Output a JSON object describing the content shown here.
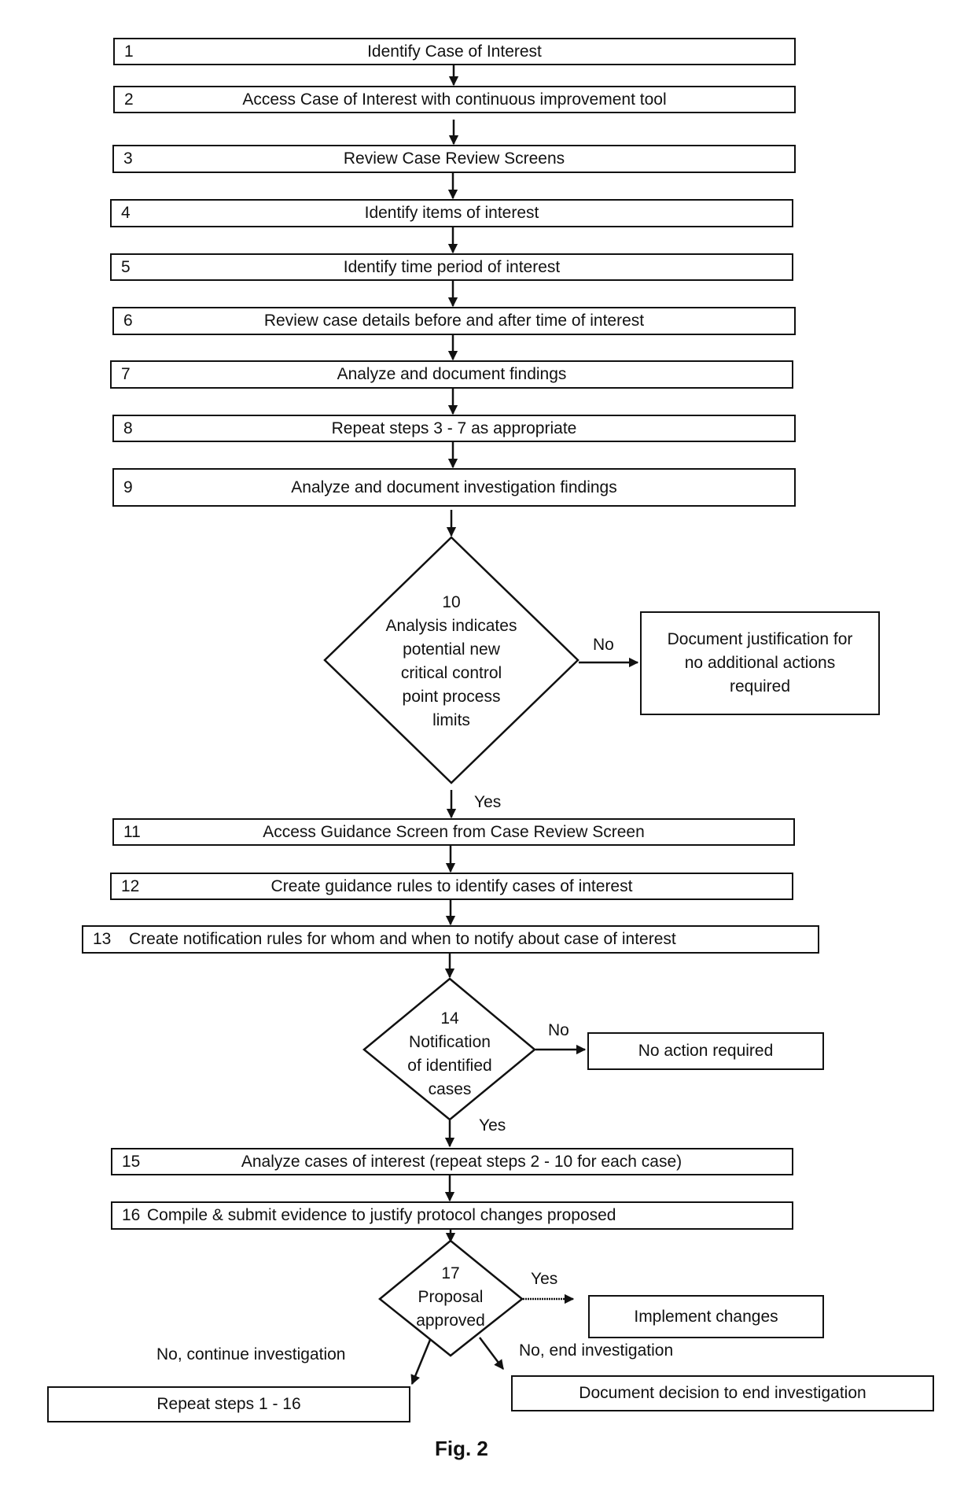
{
  "figure": {
    "caption": "Fig. 2",
    "steps": [
      {
        "num": "1",
        "label": "Identify Case of Interest"
      },
      {
        "num": "2",
        "label": "Access Case of Interest with continuous improvement tool"
      },
      {
        "num": "3",
        "label": "Review Case Review Screens"
      },
      {
        "num": "4",
        "label": "Identify items of interest"
      },
      {
        "num": "5",
        "label": "Identify time period of interest"
      },
      {
        "num": "6",
        "label": "Review case details before and after time of interest"
      },
      {
        "num": "7",
        "label": "Analyze and document findings"
      },
      {
        "num": "8",
        "label": "Repeat steps 3 - 7 as appropriate"
      },
      {
        "num": "9",
        "label": "Analyze and document investigation findings"
      },
      {
        "num": "11",
        "label": "Access Guidance Screen from Case Review Screen"
      },
      {
        "num": "12",
        "label": "Create guidance rules to identify cases of interest"
      },
      {
        "num": "13",
        "label": "Create notification rules for whom and when to notify about case of interest"
      },
      {
        "num": "15",
        "label": "Analyze cases of interest (repeat steps 2 - 10 for each case)"
      },
      {
        "num": "16",
        "label": "Compile & submit evidence to justify protocol changes proposed"
      }
    ],
    "decisions": [
      {
        "num": "10",
        "lines": [
          "Analysis indicates",
          "potential new",
          "critical control",
          "point process",
          "limits"
        ],
        "no_label": "No",
        "yes_label": "Yes",
        "no_outcome": "Document justification for no additional actions required"
      },
      {
        "num": "14",
        "lines": [
          "Notification",
          "of identified",
          "cases"
        ],
        "no_label": "No",
        "yes_label": "Yes",
        "no_outcome": "No action required"
      },
      {
        "num": "17",
        "lines": [
          "Proposal",
          "approved"
        ],
        "yes_label": "Yes",
        "yes_outcome": "Implement changes",
        "no_continue_label": "No, continue investigation",
        "no_continue_outcome": "Repeat steps 1 - 16",
        "no_end_label": "No, end investigation",
        "no_end_outcome": "Document decision to end investigation"
      }
    ]
  }
}
